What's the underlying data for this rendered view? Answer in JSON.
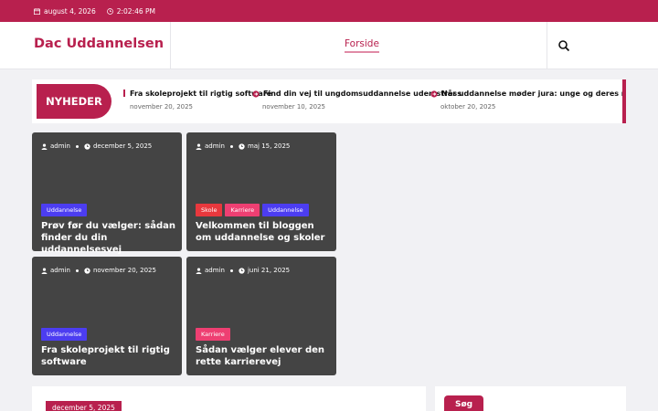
{
  "topbar": {
    "date": "august 4, 2026",
    "time": "2:02:46 PM"
  },
  "header": {
    "site_title": "Dac Uddannelsen",
    "nav_home": "Forside"
  },
  "ticker": {
    "label": "NYHEDER",
    "items": [
      {
        "title": "Fra skoleprojekt til rigtig software",
        "date": "november 20, 2025"
      },
      {
        "title": "Find din vej til ungdomsuddannelse uden stress",
        "date": "november 10, 2025"
      },
      {
        "title": "Når uddannelse møder jura: unge og deres rettigh",
        "date": "oktober 20, 2025"
      }
    ]
  },
  "cards": [
    {
      "author": "admin",
      "date": "december 5, 2025",
      "tags": [
        "Uddannelse"
      ],
      "title": "Prøv før du vælger: sådan finder du din uddannelsesvej"
    },
    {
      "author": "admin",
      "date": "maj 15, 2025",
      "tags": [
        "Skole",
        "Karriere",
        "Uddannelse"
      ],
      "title": "Velkommen til bloggen om uddannelse og skoler"
    },
    {
      "author": "admin",
      "date": "november 20, 2025",
      "tags": [
        "Uddannelse"
      ],
      "title": "Fra skoleprojekt til rigtig software"
    },
    {
      "author": "admin",
      "date": "juni 21, 2025",
      "tags": [
        "Karriere"
      ],
      "title": "Sådan vælger elever den rette karrierevej"
    }
  ],
  "post": {
    "date": "december 5, 2025"
  },
  "sidebar": {
    "search_label": "Søg"
  },
  "colors": {
    "brand": "#b8204e",
    "card_bg": "#444444",
    "tag_uddannelse": "#4c3df1",
    "tag_skole": "#e8383d",
    "tag_karriere": "#ee3f72"
  }
}
